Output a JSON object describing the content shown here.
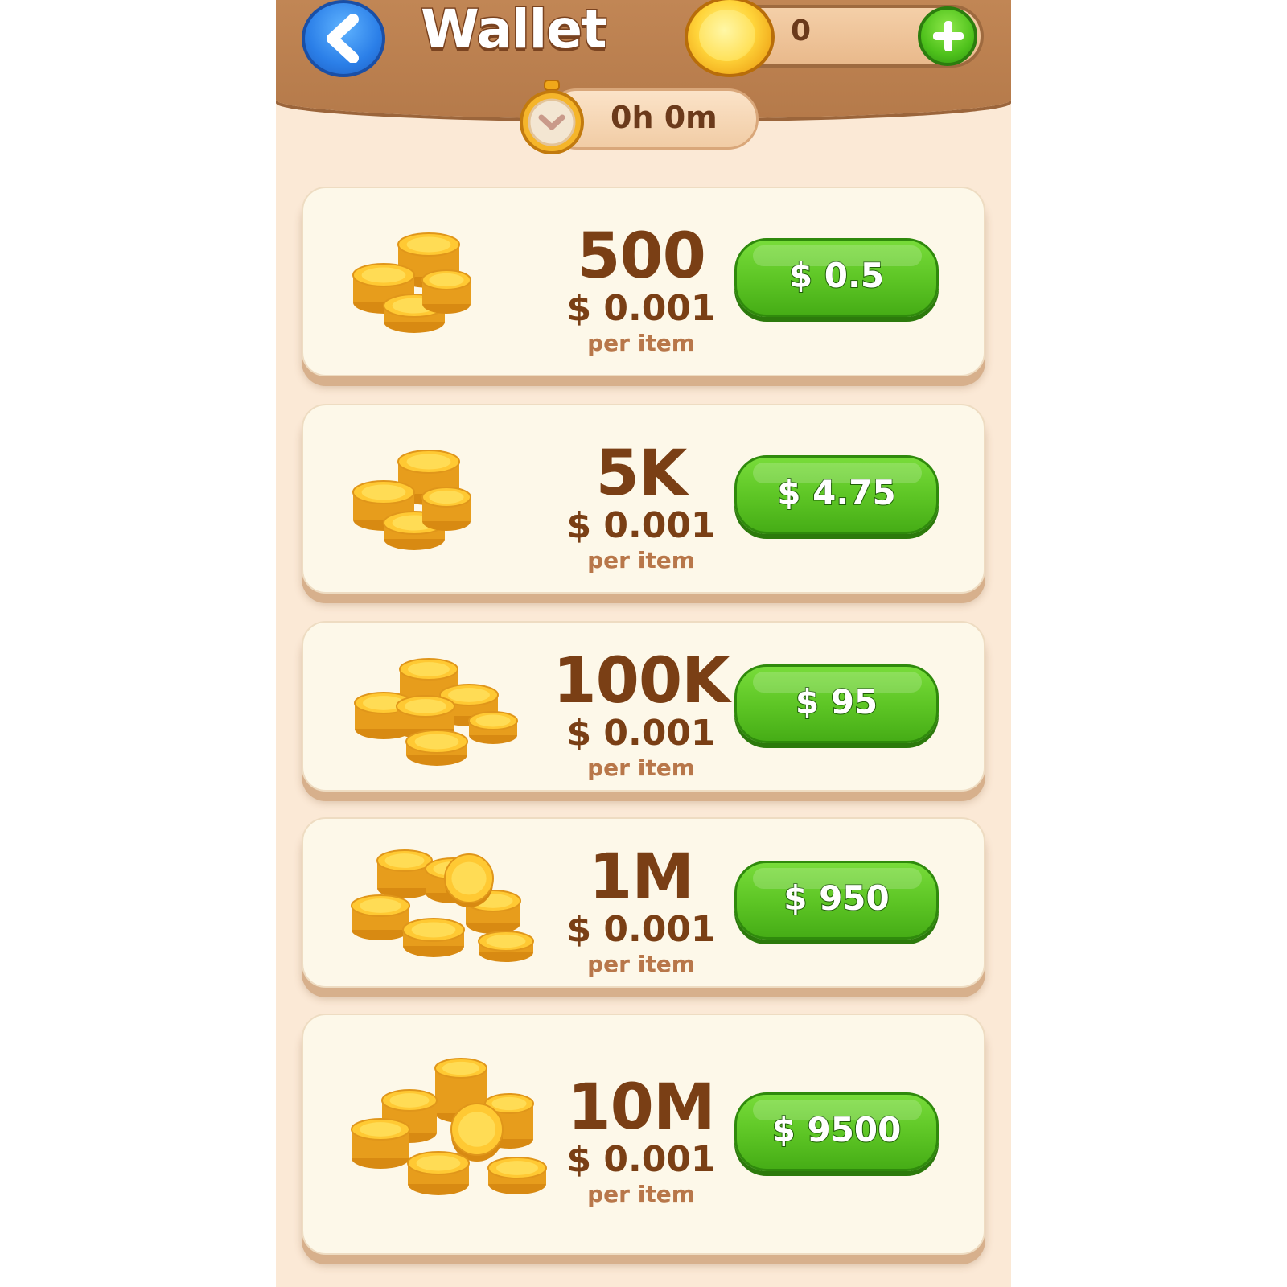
{
  "header": {
    "title": "Wallet",
    "balance": "0",
    "timer": "0h 0m"
  },
  "offers": [
    {
      "amount": "500",
      "unit_price": "$ 0.001",
      "per_item": "per item",
      "price": "$ 0.5"
    },
    {
      "amount": "5K",
      "unit_price": "$ 0.001",
      "per_item": "per item",
      "price": "$ 4.75"
    },
    {
      "amount": "100K",
      "unit_price": "$ 0.001",
      "per_item": "per item",
      "price": "$ 95"
    },
    {
      "amount": "1M",
      "unit_price": "$ 0.001",
      "per_item": "per item",
      "price": "$ 950"
    },
    {
      "amount": "10M",
      "unit_price": "$ 0.001",
      "per_item": "per item",
      "price": "$ 9500"
    }
  ],
  "icons": {
    "back": "chevron-left-icon",
    "balance": "coin-icon",
    "add": "plus-icon",
    "timer": "stopwatch-icon",
    "offer": "coin-stack-icon"
  },
  "colors": {
    "header_brown": "#b57a4a",
    "background": "#fbe9d6",
    "card": "#fdf8e9",
    "buy_green": "#5cc424",
    "text_brown": "#7a3f15",
    "back_blue": "#2b7fe8"
  }
}
